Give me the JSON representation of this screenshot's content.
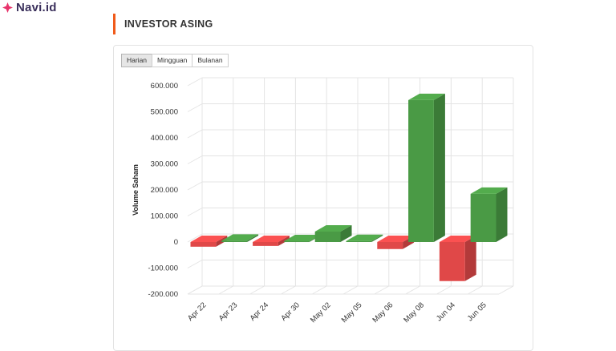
{
  "brand": {
    "name": "Navi.id",
    "accent": "#e8336b"
  },
  "section": {
    "title": "INVESTOR ASING",
    "accent": "#f05a1a"
  },
  "tabs": [
    {
      "label": "Harian",
      "active": true
    },
    {
      "label": "Mingguan",
      "active": false
    },
    {
      "label": "Bulanan",
      "active": false
    }
  ],
  "chart_data": {
    "type": "bar",
    "render": "3d",
    "ylabel": "Volume Saham",
    "ylim": [
      -200000,
      600000
    ],
    "yticks": [
      600000,
      500000,
      400000,
      300000,
      200000,
      100000,
      0,
      -100000,
      -200000
    ],
    "ytick_labels": [
      "600.000",
      "500.000",
      "400.000",
      "300.000",
      "200.000",
      "100.000",
      "0",
      "-100.000",
      "-200.000"
    ],
    "categories": [
      "Apr 22",
      "Apr 23",
      "Apr 24",
      "Apr 30",
      "May 02",
      "May 05",
      "May 06",
      "May 08",
      "Jun 04",
      "Jun 05"
    ],
    "values": [
      -18000,
      5000,
      -15000,
      3000,
      40000,
      4000,
      -27000,
      545000,
      -150000,
      185000
    ],
    "colors": {
      "positive": "#4a9a45",
      "negative": "#e04848"
    },
    "grid": true,
    "legend": "none"
  }
}
